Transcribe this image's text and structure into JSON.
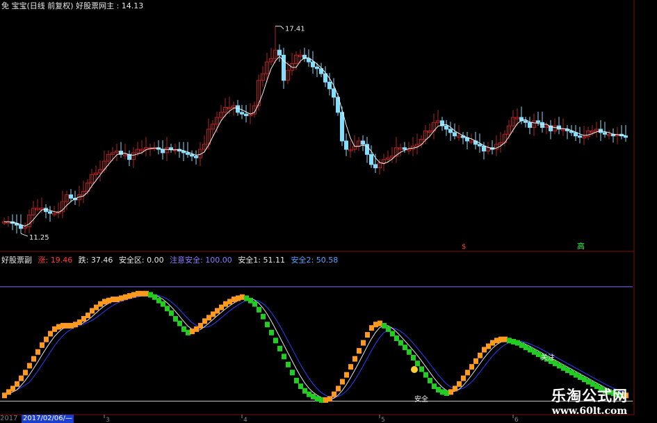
{
  "header_top": {
    "text": "免 宝宝(日线 前复权) 好股票网主 : 14.13"
  },
  "header_bottom": {
    "name": "好股票副",
    "zhang": "涨: 19.46",
    "die": "跌: 37.46",
    "safe_zone": "安全区: 0.00",
    "attention": "注意安全: 100.00",
    "safe1": "安全1: 51.11",
    "safe2": "安全2: 50.58"
  },
  "price_labels": {
    "high": "17.41",
    "low": "11.25"
  },
  "signal_labels": {
    "buy_small": "$",
    "buy_big": "高"
  },
  "annotations": {
    "safe": "安全",
    "attention": "关注"
  },
  "axis": {
    "year": "2017",
    "date_box": "2017/02/06/—",
    "months": [
      "3",
      "4",
      "5",
      "6"
    ]
  },
  "watermark": {
    "title": "乐淘公式网",
    "url": "www.60lt.com"
  },
  "colors": {
    "up_candle": "#b82020",
    "down_candle": "#7fe0ff",
    "ma_line": "#f2f2f2",
    "osc_orange": "#ff9a1f",
    "osc_green": "#22cc22",
    "level_line": "#7a6cff",
    "blue_line": "#2a3fff"
  },
  "chart_data": [
    {
      "type": "candlestick",
      "title": "",
      "x": [
        "1",
        "2",
        "3",
        "4",
        "5",
        "6",
        "7",
        "8",
        "9",
        "10",
        "11",
        "12",
        "13",
        "14",
        "15",
        "16",
        "17",
        "18",
        "19",
        "20",
        "21",
        "22",
        "23",
        "24",
        "25",
        "26",
        "27",
        "28",
        "29",
        "30",
        "31",
        "32",
        "33",
        "34",
        "35",
        "36",
        "37",
        "38",
        "39",
        "40",
        "41",
        "42",
        "43",
        "44",
        "45",
        "46",
        "47",
        "48",
        "49",
        "50",
        "51",
        "52",
        "53",
        "54",
        "55",
        "56",
        "57",
        "58",
        "59",
        "60",
        "61",
        "62",
        "63",
        "64",
        "65",
        "66",
        "67",
        "68",
        "69",
        "70",
        "71",
        "72",
        "73",
        "74",
        "75",
        "76",
        "77",
        "78",
        "79",
        "80",
        "81",
        "82",
        "83",
        "84",
        "85",
        "86",
        "87",
        "88",
        "89",
        "90",
        "91",
        "92",
        "93",
        "94",
        "95",
        "96",
        "97",
        "98",
        "99",
        "100",
        "101",
        "102",
        "103",
        "104",
        "105",
        "106",
        "107",
        "108",
        "109",
        "110",
        "111",
        "112",
        "113",
        "114",
        "115",
        "116",
        "117",
        "118",
        "119",
        "120",
        "121",
        "122",
        "123",
        "124",
        "125",
        "126",
        "127",
        "128",
        "129",
        "130",
        "131",
        "132",
        "133",
        "134",
        "135",
        "136",
        "137",
        "138",
        "139",
        "140",
        "141",
        "142",
        "143",
        "144",
        "145",
        "146",
        "147",
        "148",
        "149",
        "150"
      ],
      "close": [
        11.6,
        11.6,
        11.55,
        11.5,
        11.4,
        11.45,
        11.8,
        12.0,
        12.0,
        12.0,
        11.9,
        11.85,
        11.85,
        11.9,
        12.2,
        12.4,
        12.3,
        12.25,
        12.4,
        12.5,
        12.75,
        13.0,
        13.05,
        13.15,
        13.4,
        13.6,
        13.65,
        13.7,
        13.6,
        13.6,
        13.45,
        13.65,
        13.75,
        13.75,
        13.8,
        13.8,
        13.8,
        13.75,
        13.65,
        13.8,
        13.75,
        13.75,
        13.7,
        13.65,
        13.6,
        13.55,
        13.5,
        13.75,
        13.9,
        14.35,
        14.5,
        14.7,
        14.85,
        15.0,
        15.0,
        15.05,
        14.85,
        14.8,
        14.75,
        14.8,
        15.05,
        15.8,
        16.0,
        16.35,
        16.45,
        16.7,
        16.55,
        15.8,
        16.1,
        16.3,
        16.55,
        16.55,
        16.45,
        16.35,
        16.2,
        16.15,
        16.0,
        15.75,
        15.55,
        15.3,
        14.85,
        14.0,
        13.75,
        13.75,
        13.85,
        14.0,
        13.9,
        13.6,
        13.3,
        13.2,
        13.35,
        13.45,
        13.5,
        13.55,
        13.8,
        13.8,
        13.75,
        13.75,
        13.85,
        13.9,
        14.05,
        14.3,
        14.3,
        14.55,
        14.6,
        14.45,
        14.35,
        14.25,
        14.15,
        14.15,
        14.1,
        14.0,
        14.0,
        13.9,
        13.85,
        13.7,
        13.8,
        13.75,
        13.9,
        13.95,
        14.2,
        14.45,
        14.7,
        14.7,
        14.6,
        14.55,
        14.4,
        14.6,
        14.55,
        14.4,
        14.45,
        14.3,
        14.45,
        14.35,
        14.35,
        14.3,
        14.25,
        14.15,
        14.13,
        14.13,
        14.3,
        14.3,
        14.35,
        14.25,
        14.2,
        14.2,
        14.15,
        14.2,
        14.15,
        14.13
      ],
      "high": 17.41,
      "low": 11.25,
      "ylim": [
        10.8,
        17.9
      ]
    },
    {
      "type": "line",
      "title": "",
      "series": [
        {
          "name": "",
          "values": [
            5,
            8,
            11,
            15,
            20,
            25,
            31,
            37,
            43,
            49,
            54,
            59,
            63,
            65,
            66,
            66,
            66,
            67,
            69,
            72,
            75,
            79,
            82,
            85,
            87,
            88,
            89,
            89,
            90,
            91,
            92,
            93,
            94,
            94,
            94,
            93,
            91,
            88,
            85,
            81,
            77,
            72,
            68,
            63,
            60,
            61,
            63,
            66,
            70,
            73,
            76,
            79,
            82,
            85,
            87,
            89,
            90,
            91,
            90,
            88,
            85,
            80,
            74,
            67,
            60,
            53,
            46,
            39,
            32,
            25,
            18,
            13,
            9,
            6,
            4,
            2,
            1,
            1,
            2,
            6,
            11,
            17,
            23,
            30,
            37,
            44,
            51,
            58,
            64,
            67,
            68,
            66,
            63,
            59,
            55,
            51,
            47,
            43,
            38,
            33,
            28,
            23,
            18,
            13,
            10,
            8,
            7,
            8,
            11,
            15,
            20,
            25,
            30,
            35,
            40,
            45,
            48,
            51,
            53,
            54,
            54,
            53,
            52,
            51,
            49,
            47,
            45,
            43,
            41,
            39,
            37,
            35,
            33,
            31,
            29,
            27,
            25,
            23,
            21,
            19,
            17,
            15,
            13,
            11,
            9,
            8,
            7,
            6,
            5,
            5
          ]
        }
      ],
      "levels": [
        100,
        0
      ],
      "ylim": [
        -10,
        120
      ]
    }
  ]
}
